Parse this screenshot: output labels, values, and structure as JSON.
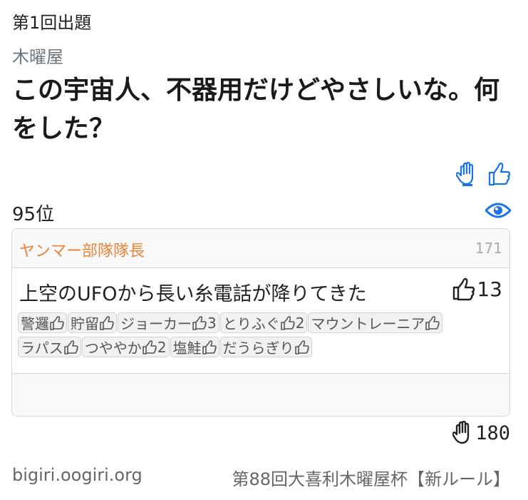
{
  "round_label": "第1回出題",
  "host": "木曜屋",
  "question": "この宇宙人、不器用だけどやさしいな。何をした？",
  "icons": {
    "raise_hand": "hand-raise-icon",
    "like": "thumbs-up-icon",
    "view": "eye-icon"
  },
  "colors": {
    "accent_blue": "#1a73e8",
    "author_orange": "#e8853a"
  },
  "rank": "95位",
  "answer_card": {
    "author": "ヤンマー部隊隊長",
    "author_id": "171",
    "answer_text": "上空のUFOから長い糸電話が降りてきた",
    "votes": "13",
    "voters": [
      {
        "name": "警邏",
        "count": ""
      },
      {
        "name": "貯留",
        "count": ""
      },
      {
        "name": "ジョーカー",
        "count": "3"
      },
      {
        "name": "とりふぐ",
        "count": "2"
      },
      {
        "name": "マウントレーニア",
        "count": ""
      },
      {
        "name": "ラパス",
        "count": ""
      },
      {
        "name": "つややか",
        "count": "2"
      },
      {
        "name": "塩鮭",
        "count": ""
      },
      {
        "name": "だうらぎり",
        "count": ""
      }
    ]
  },
  "total_count": "180",
  "footer": {
    "site": "bigiri.oogiri.org",
    "contest": "第88回大喜利木曜屋杯【新ルール】"
  }
}
